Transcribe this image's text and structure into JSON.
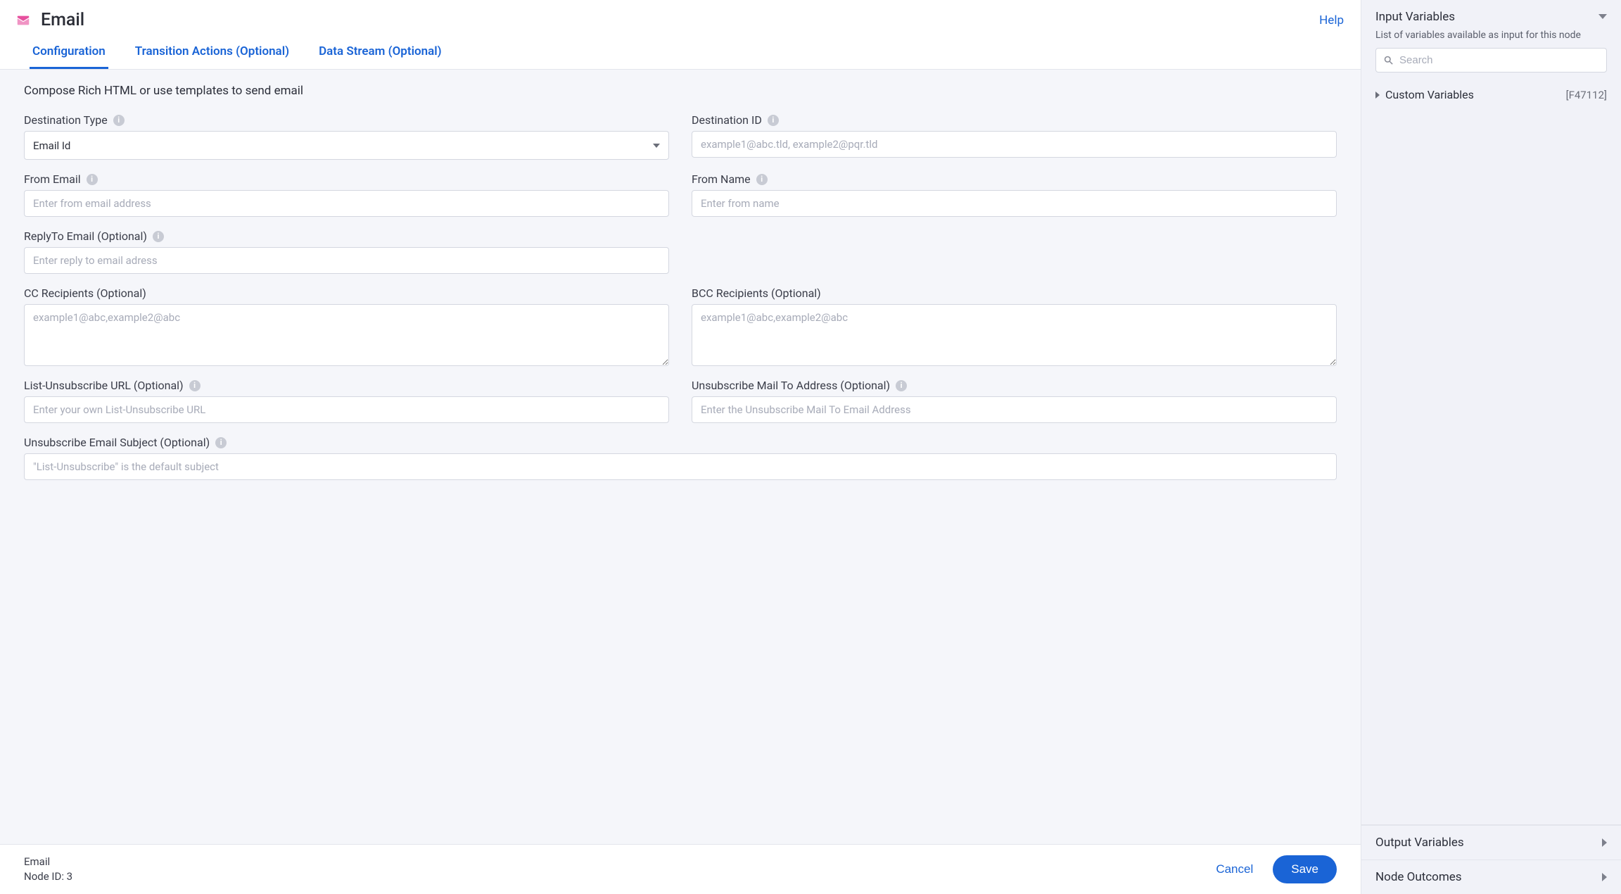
{
  "header": {
    "title": "Email",
    "help_label": "Help"
  },
  "tabs": [
    {
      "label": "Configuration",
      "active": true
    },
    {
      "label": "Transition Actions (Optional)",
      "active": false
    },
    {
      "label": "Data Stream (Optional)",
      "active": false
    }
  ],
  "form": {
    "description": "Compose Rich HTML or use templates to send email",
    "destination_type": {
      "label": "Destination Type",
      "value": "Email Id"
    },
    "destination_id": {
      "label": "Destination ID",
      "placeholder": "example1@abc.tld, example2@pqr.tld",
      "value": ""
    },
    "from_email": {
      "label": "From Email",
      "placeholder": "Enter from email address",
      "value": ""
    },
    "from_name": {
      "label": "From Name",
      "placeholder": "Enter from name",
      "value": ""
    },
    "replyto_email": {
      "label": "ReplyTo Email (Optional)",
      "placeholder": "Enter reply to email adress",
      "value": ""
    },
    "cc": {
      "label": "CC Recipients (Optional)",
      "placeholder": "example1@abc,example2@abc",
      "value": ""
    },
    "bcc": {
      "label": "BCC Recipients (Optional)",
      "placeholder": "example1@abc,example2@abc",
      "value": ""
    },
    "list_unsub_url": {
      "label": "List-Unsubscribe URL (Optional)",
      "placeholder": "Enter your own List-Unsubscribe URL",
      "value": ""
    },
    "unsub_mailto": {
      "label": "Unsubscribe Mail To Address (Optional)",
      "placeholder": "Enter the Unsubscribe Mail To Email Address",
      "value": ""
    },
    "unsub_subject": {
      "label": "Unsubscribe Email Subject (Optional)",
      "placeholder": "\"List-Unsubscribe\" is the default subject",
      "value": ""
    }
  },
  "footer": {
    "meta_line1": "Email",
    "meta_line2": "Node ID: 3",
    "cancel_label": "Cancel",
    "save_label": "Save"
  },
  "right": {
    "input_vars": {
      "title": "Input Variables",
      "subtitle": "List of variables available as input for this node",
      "search_placeholder": "Search",
      "groups": [
        {
          "label": "Custom Variables",
          "id": "[F47112]"
        }
      ]
    },
    "output_vars": {
      "title": "Output Variables"
    },
    "node_outcomes": {
      "title": "Node Outcomes"
    }
  }
}
